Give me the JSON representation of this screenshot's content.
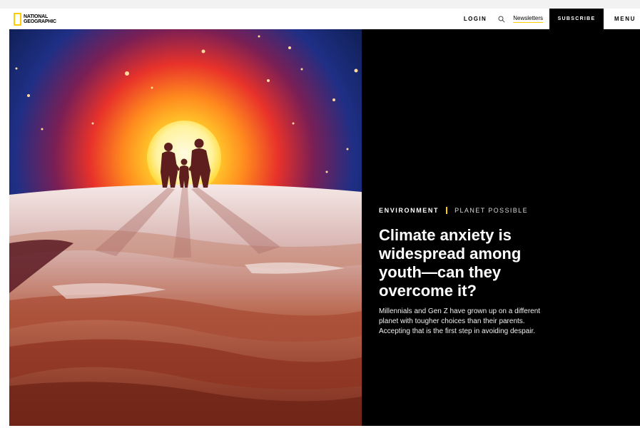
{
  "header": {
    "logo_line1": "NATIONAL",
    "logo_line2": "GEOGRAPHIC",
    "login": "LOGIN",
    "newsletters": "Newsletters",
    "subscribe": "SUBSCRIBE",
    "menu": "MENU",
    "search_icon": "search-icon"
  },
  "article": {
    "category": "ENVIRONMENT",
    "subcategory": "PLANET POSSIBLE",
    "headline": "Climate anxiety is widespread among youth—can they overcome it?",
    "dek": "Millennials and Gen Z have grown up on a different planet with tougher choices than their parents. Accepting that is the first step in avoiding despair."
  },
  "colors": {
    "brand_yellow": "#ffce00",
    "hero_background": "#000000"
  }
}
